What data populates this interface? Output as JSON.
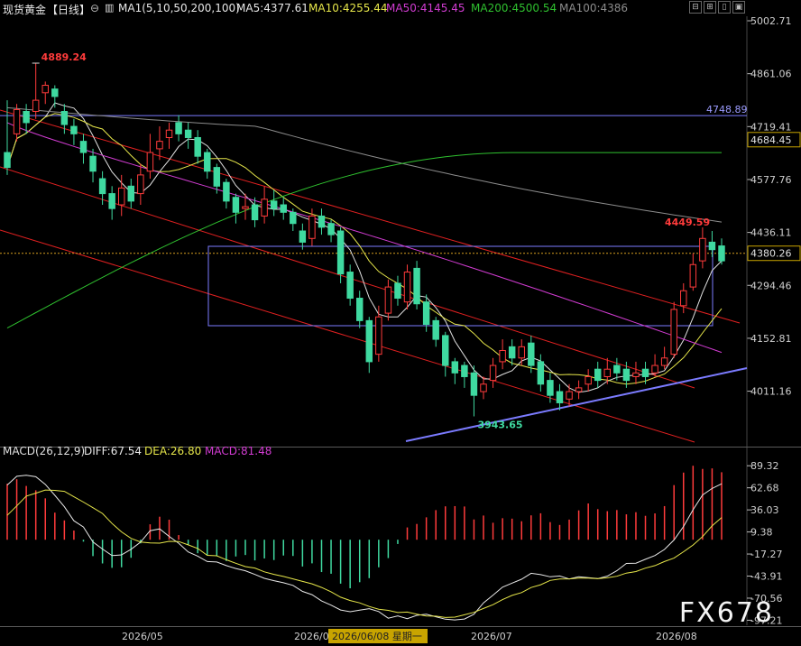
{
  "header": {
    "symbol": "现货黄金",
    "period": "【日线】",
    "ma_set": "MA1(5,10,50,200,100)",
    "ma5": "MA5:4377.61",
    "ma10": "MA10:4255.44",
    "ma50": "MA50:4145.45",
    "ma200": "MA200:4500.54",
    "ma100": "MA100:4386",
    "colors": {
      "ma5": "#e0e0e0",
      "ma10": "#e6e64a",
      "ma50": "#d23cd2",
      "ma200": "#2fc12f",
      "ma100": "#8c8c8c"
    }
  },
  "macd_header": {
    "params": "MACD(26,12,9)",
    "diff": "DIFF:67.54",
    "dea": "DEA:26.80",
    "macd": "MACD:81.48"
  },
  "x_labels": [
    "2026/05",
    "2026/06",
    "2026/07",
    "2026/08"
  ],
  "crosshair_label": "2026/06/08 星期一",
  "watermark": "FX678",
  "chart_data": [
    {
      "type": "candlestick",
      "title": "现货黄金【日线】",
      "y_ticks": [
        5002.71,
        4861.06,
        4719.41,
        4577.76,
        4436.11,
        4294.46,
        4152.81,
        4011.16
      ],
      "ylim": [
        3870,
        5010
      ],
      "annotations": {
        "high": "4889.24",
        "low": "3943.65",
        "recent_high": "4449.59",
        "resistance_level": "4748.89",
        "resistance_value": 4748.89,
        "price_tag": "4684.45",
        "price_tag_value": 4684.45,
        "current": "4380.26",
        "current_value": 4380.26
      },
      "close": [
        4610,
        4765,
        4730,
        4790,
        4830,
        4800,
        4725,
        4700,
        4650,
        4600,
        4540,
        4500,
        4555,
        4520,
        4590,
        4650,
        4680,
        4710,
        4700,
        4690,
        4640,
        4600,
        4560,
        4520,
        4490,
        4505,
        4470,
        4525,
        4500,
        4490,
        4460,
        4410,
        4480,
        4450,
        4430,
        4325,
        4260,
        4200,
        4090,
        4210,
        4290,
        4260,
        4330,
        4245,
        4190,
        4150,
        4080,
        4060,
        4050,
        4000,
        4030,
        4080,
        4120,
        4100,
        4130,
        4080,
        4030,
        4000,
        3980,
        4010,
        4020,
        4050,
        4040,
        4070,
        4060,
        4040,
        4060,
        4050,
        4080,
        4100,
        4230,
        4280,
        4350,
        4420,
        4390,
        4360
      ],
      "open": [
        4650,
        4700,
        4760,
        4760,
        4810,
        4820,
        4760,
        4720,
        4680,
        4640,
        4580,
        4540,
        4510,
        4560,
        4540,
        4600,
        4660,
        4690,
        4730,
        4710,
        4690,
        4650,
        4610,
        4570,
        4530,
        4500,
        4510,
        4480,
        4520,
        4510,
        4490,
        4440,
        4420,
        4480,
        4460,
        4440,
        4330,
        4260,
        4200,
        4110,
        4220,
        4300,
        4250,
        4340,
        4250,
        4200,
        4160,
        4090,
        4080,
        4060,
        4010,
        4040,
        4090,
        4130,
        4100,
        4140,
        4090,
        4040,
        4010,
        3990,
        4010,
        4030,
        4070,
        4050,
        4080,
        4070,
        4050,
        4070,
        4060,
        4080,
        4110,
        4240,
        4290,
        4360,
        4410,
        4400
      ],
      "high": [
        4790,
        4780,
        4780,
        4889.24,
        4840,
        4830,
        4780,
        4740,
        4700,
        4660,
        4600,
        4560,
        4590,
        4580,
        4620,
        4700,
        4720,
        4730,
        4750,
        4730,
        4710,
        4660,
        4620,
        4580,
        4540,
        4540,
        4530,
        4560,
        4550,
        4530,
        4500,
        4460,
        4500,
        4500,
        4470,
        4450,
        4350,
        4280,
        4210,
        4240,
        4310,
        4320,
        4350,
        4360,
        4270,
        4210,
        4170,
        4100,
        4090,
        4080,
        4050,
        4100,
        4150,
        4150,
        4150,
        4160,
        4110,
        4060,
        4030,
        4030,
        4040,
        4070,
        4090,
        4100,
        4100,
        4090,
        4090,
        4090,
        4110,
        4130,
        4250,
        4300,
        4380,
        4449.59,
        4440,
        4420
      ],
      "low": [
        4590,
        4680,
        4700,
        4740,
        4780,
        4770,
        4700,
        4670,
        4620,
        4570,
        4510,
        4470,
        4480,
        4500,
        4510,
        4580,
        4630,
        4660,
        4680,
        4660,
        4620,
        4580,
        4540,
        4500,
        4460,
        4470,
        4450,
        4460,
        4480,
        4470,
        4440,
        4390,
        4400,
        4430,
        4410,
        4300,
        4240,
        4180,
        4060,
        4090,
        4200,
        4240,
        4230,
        4230,
        4170,
        4130,
        4050,
        4030,
        4020,
        3943.65,
        3990,
        4020,
        4070,
        4080,
        4080,
        4060,
        4010,
        3980,
        3960,
        3970,
        3990,
        4010,
        4020,
        4030,
        4040,
        4020,
        4030,
        4030,
        4050,
        4070,
        4100,
        4220,
        4280,
        4340,
        4370,
        4350
      ]
    },
    {
      "type": "macd",
      "title": "MACD(26,12,9)",
      "y_ticks": [
        89.32,
        62.68,
        36.03,
        9.38,
        -17.27,
        -43.91,
        -70.56,
        -97.21
      ],
      "ylim": [
        -100,
        95
      ],
      "series_names": [
        "DIFF",
        "DEA",
        "MACD"
      ],
      "diff": [
        66.04,
        76.58,
        77.8,
        76.01,
        66.86,
        53.62,
        39.78,
        22.85,
        15.32,
        -2.61,
        -11.21,
        -19.14,
        -18.32,
        -11.59,
        -2.93,
        10.95,
        13.09,
        4.02,
        -4.29,
        -14.66,
        -19.79,
        -26.34,
        -26.86,
        -31.28,
        -34.76,
        -37.44,
        -41.98,
        -46.63,
        -49.46,
        -51.97,
        -55.12,
        -62.37,
        -66.38,
        -73.91,
        -78.94,
        -84.85,
        -86.89,
        -84.99,
        -83.2,
        -86.66,
        -94.81,
        -92.09,
        -95.33,
        -91.3,
        -89.96,
        -93.05,
        -96.0,
        -96.82,
        -95.73,
        -89.97,
        -76.21,
        -66.88,
        -57.34,
        -52.37,
        -47.72,
        -40.53,
        -42.19,
        -44.75,
        -43.77,
        -47.43,
        -44.64,
        -45.87,
        -46.94,
        -43.91,
        -37.43,
        -28.62,
        -28.32,
        -23.58,
        -19.05,
        -11.77,
        -0.34,
        16.01,
        36.19,
        53.99,
        61.84,
        67.54
      ],
      "dea": [
        29.4,
        40.89,
        52.66,
        56.24,
        60.06,
        59.58,
        58.39,
        51.81,
        45.41,
        38.68,
        31.69,
        19.66,
        9.48,
        1.69,
        -2.74,
        -3.83,
        -4.14,
        -1.92,
        -2.17,
        -6.2,
        -10.56,
        -18.8,
        -19.36,
        -24.21,
        -28.41,
        -32.46,
        -34.19,
        -38.81,
        -41.87,
        -44.3,
        -47.3,
        -50.35,
        -53.22,
        -57.58,
        -62.89,
        -69.41,
        -73.37,
        -76.24,
        -80.66,
        -83.85,
        -85.28,
        -87.89,
        -87.41,
        -90.03,
        -92.08,
        -92.31,
        -93.91,
        -93.51,
        -90.59,
        -87.68,
        -83.04,
        -78.38,
        -72.29,
        -67.21,
        -63.83,
        -57.71,
        -54.36,
        -49.12,
        -47.48,
        -47.22,
        -46.38,
        -46.42,
        -47.11,
        -45.99,
        -44.15,
        -40.31,
        -38.43,
        -34.26,
        -31.24,
        -26.34,
        -22.19,
        -14.46,
        -6.41,
        3.81,
        16.64,
        26.8
      ],
      "macd": [
        67.54,
        73.02,
        64.92,
        59.67,
        49.96,
        32.71,
        23.33,
        11.09,
        -2.3,
        -19.79,
        -28.66,
        -33.92,
        -33.26,
        -21.81,
        -4.4,
        18.62,
        27.8,
        24.23,
        5.61,
        -5.92,
        -16.31,
        -18.79,
        -19.99,
        -25.66,
        -20.22,
        -18.47,
        -24.97,
        -22.59,
        -24.56,
        -19.08,
        -19.62,
        -32.34,
        -28.52,
        -39.03,
        -41.1,
        -53.06,
        -58.63,
        -51.3,
        -46.41,
        -33.3,
        -22.18,
        -5.14,
        14.84,
        19.06,
        27.04,
        35.74,
        40.31,
        40.56,
        40.12,
        24.48,
        29.2,
        20.5,
        25.98,
        25.45,
        22.3,
        29.42,
        31.93,
        21.27,
        17.84,
        24.31,
        35.42,
        43.81,
        36.93,
        34.47,
        35.85,
        30.68,
        33.25,
        28.86,
        31.78,
        40.58,
        65.93,
        81.05,
        89.32,
        85.48,
        86.12,
        81.48
      ]
    }
  ]
}
